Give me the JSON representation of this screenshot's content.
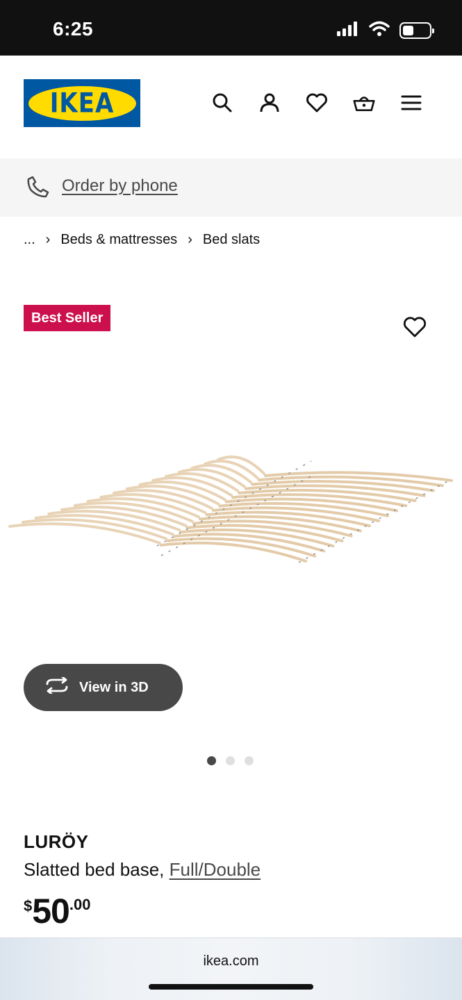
{
  "status_bar": {
    "time": "6:25",
    "icons": [
      "signal-icon",
      "wifi-icon",
      "battery-icon"
    ]
  },
  "header": {
    "logo_text": "IKEA",
    "icons": [
      "search-icon",
      "account-icon",
      "wishlist-icon",
      "cart-icon",
      "menu-icon"
    ],
    "colors": {
      "logo_blue": "#0058a3",
      "logo_yellow": "#ffdb00"
    }
  },
  "phone_bar": {
    "link_label": "Order by phone",
    "icon": "phone-icon"
  },
  "breadcrumb": {
    "ellipsis": "...",
    "items": [
      "Beds & mattresses",
      "Bed slats"
    ]
  },
  "product": {
    "badge": "Best Seller",
    "badge_color": "#cc0f4d",
    "view_3d_label": "View in 3D",
    "image_count": 3,
    "active_image": 1,
    "name": "LURÖY",
    "description": "Slatted bed base,",
    "size": "Full/Double",
    "price": {
      "currency": "$",
      "integer": "50",
      "decimal": ".00"
    }
  },
  "browser": {
    "url": "ikea.com"
  }
}
